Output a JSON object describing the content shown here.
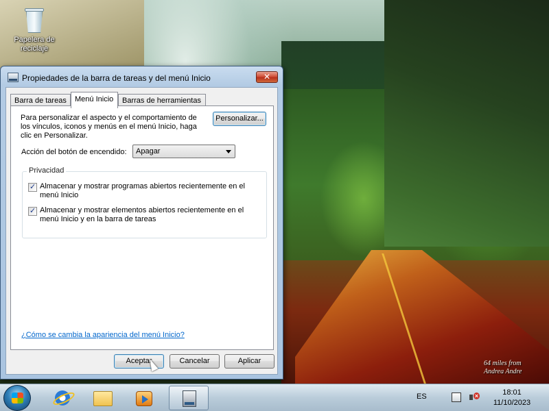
{
  "desktop": {
    "icons": [
      {
        "label_line1": "Papelera de",
        "label_line2": "reciclaje",
        "icon": "recycle-bin-icon"
      }
    ],
    "signature_line1": "64 miles from",
    "signature_line2": "Andrea Andre"
  },
  "window": {
    "title": "Propiedades de la barra de tareas y del menú Inicio",
    "close_label": "✕",
    "tabs": [
      {
        "label": "Barra de tareas"
      },
      {
        "label": "Menú Inicio"
      },
      {
        "label": "Barras de herramientas"
      }
    ],
    "active_tab": "Menú Inicio",
    "description": "Para personalizar el aspecto y el comportamiento de los vínculos, iconos y menús en el menú Inicio, haga clic en Personalizar.",
    "customize_label": "Personalizar...",
    "power_button": {
      "label": "Acción del botón de encendido:",
      "value": "Apagar"
    },
    "privacy": {
      "title": "Privacidad",
      "options": [
        {
          "label": "Almacenar y mostrar programas abiertos recientemente en el menú Inicio",
          "checked": true
        },
        {
          "label": "Almacenar y mostrar elementos abiertos recientemente en el menú Inicio y en la barra de tareas",
          "checked": true
        }
      ]
    },
    "help_link": "¿Cómo se cambia la apariencia del menú Inicio?",
    "buttons": {
      "ok": "Aceptar",
      "cancel": "Cancelar",
      "apply": "Aplicar"
    }
  },
  "taskbar": {
    "pinned": [
      {
        "name": "internet-explorer-icon"
      },
      {
        "name": "windows-explorer-icon"
      },
      {
        "name": "windows-media-player-icon"
      },
      {
        "name": "taskbar-properties-icon",
        "active": true
      }
    ],
    "language": "ES",
    "time": "18:01",
    "date": "11/10/2023"
  }
}
